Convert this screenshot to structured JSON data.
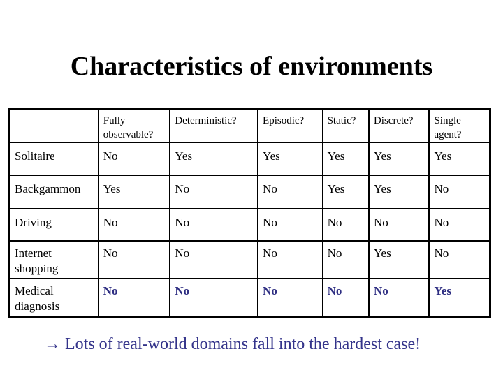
{
  "title": "Characteristics of environments",
  "table": {
    "headers": [
      "",
      "Fully observable?",
      "Deterministic?",
      "Episodic?",
      "Static?",
      "Discrete?",
      "Single agent?"
    ],
    "rows": [
      {
        "name": "Solitaire",
        "values": [
          "No",
          "Yes",
          "Yes",
          "Yes",
          "Yes",
          "Yes"
        ],
        "highlight": false
      },
      {
        "name": "Backgammon",
        "values": [
          "Yes",
          "No",
          "No",
          "Yes",
          "Yes",
          "No"
        ],
        "highlight": false
      },
      {
        "name": "Driving",
        "values": [
          "No",
          "No",
          "No",
          "No",
          "No",
          "No"
        ],
        "highlight": false
      },
      {
        "name": "Internet shopping",
        "values": [
          "No",
          "No",
          "No",
          "No",
          "Yes",
          "No"
        ],
        "highlight": false
      },
      {
        "name": "Medical diagnosis",
        "values": [
          "No",
          "No",
          "No",
          "No",
          "No",
          "Yes"
        ],
        "highlight": true
      }
    ]
  },
  "footer": {
    "arrow_icon": "right-arrow",
    "text": "→ Lots of real-world domains fall into the hardest case!"
  },
  "colors": {
    "highlight": "#2e2e82",
    "footer_text": "#33338a"
  }
}
